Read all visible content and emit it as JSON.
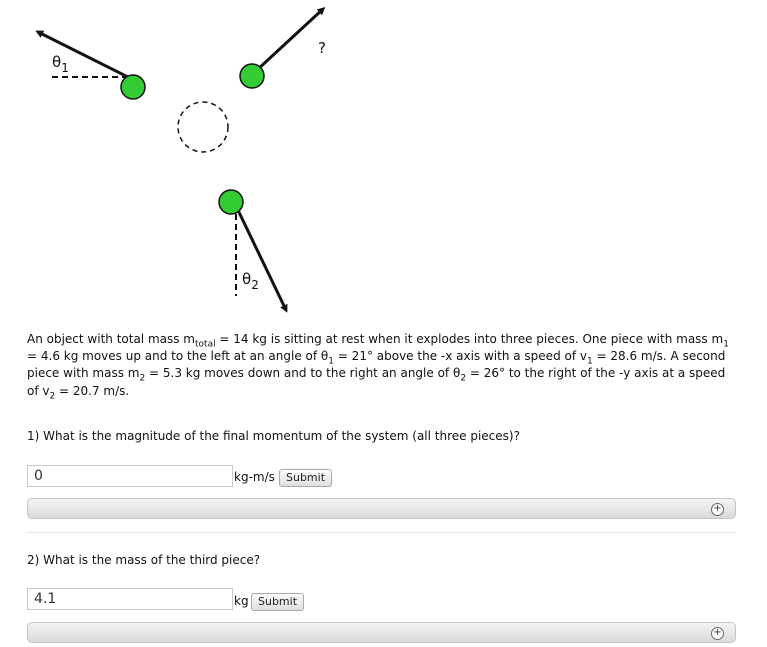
{
  "diagram": {
    "theta1_label": "θ",
    "theta1_sub": "1",
    "theta2_label": "θ",
    "theta2_sub": "2",
    "unknown_label": "?",
    "ball_color": "#33cc33"
  },
  "problem": {
    "p1": "An object with total mass m",
    "m_total_sub": "total",
    "p2": " = 14 kg is sitting at rest when it explodes into three pieces. One piece with mass m",
    "m1_sub": "1",
    "p3": " = 4.6 kg moves up and to the left at an angle of θ",
    "theta1_sub": "1",
    "p4": " = 21° above the -x axis with a speed of v",
    "v1_sub": "1",
    "p5": " = 28.6 m/s. A second piece with mass m",
    "m2_sub": "2",
    "p6": " = 5.3 kg moves down and to the right an angle of θ",
    "theta2_sub": "2",
    "p7": " = 26° to the right of the -y axis at a speed of v",
    "v2_sub": "2",
    "p8": " = 20.7 m/s."
  },
  "questions": [
    {
      "text": "1) What is the magnitude of the final momentum of the system (all three pieces)?",
      "answer_value": "0",
      "unit": "kg-m/s",
      "submit_label": "Submit",
      "hint_icon": "+"
    },
    {
      "text": "2) What is the mass of the third piece?",
      "answer_value": "4.1",
      "unit": "kg",
      "submit_label": "Submit",
      "hint_icon": "+"
    }
  ]
}
